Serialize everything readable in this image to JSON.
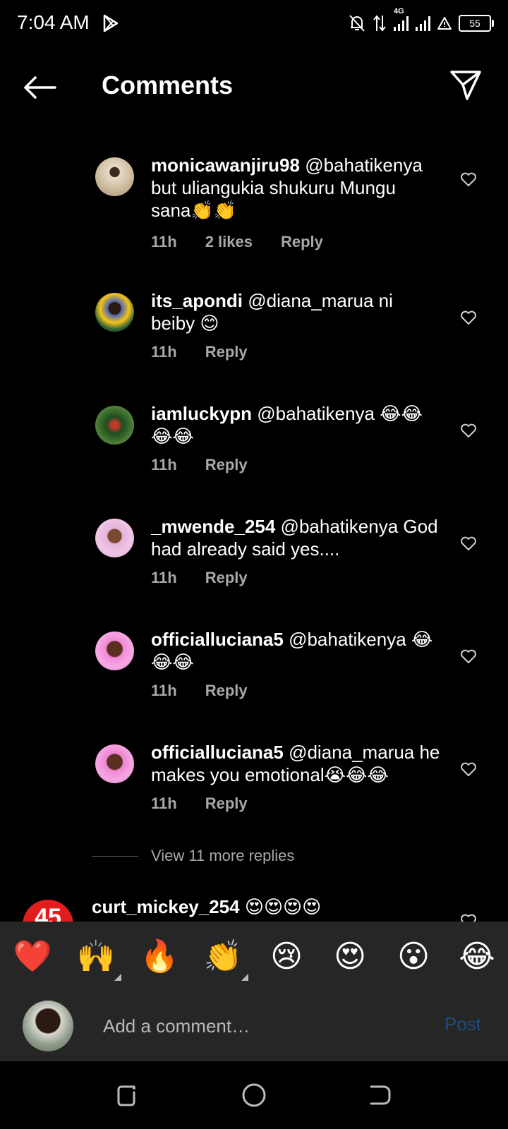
{
  "status_bar": {
    "time": "7:04 AM",
    "network": "4G",
    "battery": "55"
  },
  "header": {
    "title": "Comments"
  },
  "comments": [
    {
      "username": "monicawanjiru98",
      "text": " @bahatikenya but uliangukia shukuru Mungu sana👏👏",
      "time": "11h",
      "likes": "2 likes",
      "reply": "Reply"
    },
    {
      "username": "its_apondi",
      "text": " @diana_marua ni beiby 😊",
      "time": "11h",
      "reply": "Reply"
    },
    {
      "username": "iamluckypn",
      "text": " @bahatikenya 😂😂😂😂",
      "time": "11h",
      "reply": "Reply"
    },
    {
      "username": "_mwende_254",
      "text": " @bahatikenya God had already said yes....",
      "time": "11h",
      "reply": "Reply"
    },
    {
      "username": "officialluciana5",
      "text": " @bahatikenya 😂😂😂",
      "time": "11h",
      "reply": "Reply"
    },
    {
      "username": "officialluciana5",
      "text": " @diana_marua he makes you emotional😭😂😂",
      "time": "11h",
      "reply": "Reply"
    }
  ],
  "view_more": "View 11 more replies",
  "next_comment": {
    "username": "curt_mickey_254",
    "text": " 😍😍😍😍",
    "avatar_text": "45"
  },
  "emoji_bar": [
    "❤️",
    "🙌",
    "🔥",
    "👏",
    "😢",
    "😍",
    "😮",
    "😂"
  ],
  "input": {
    "placeholder": "Add a comment…",
    "post_label": "Post"
  },
  "colors": {
    "accent": "#1d4c7a",
    "panel": "#262626",
    "meta": "#a8a8a8"
  }
}
